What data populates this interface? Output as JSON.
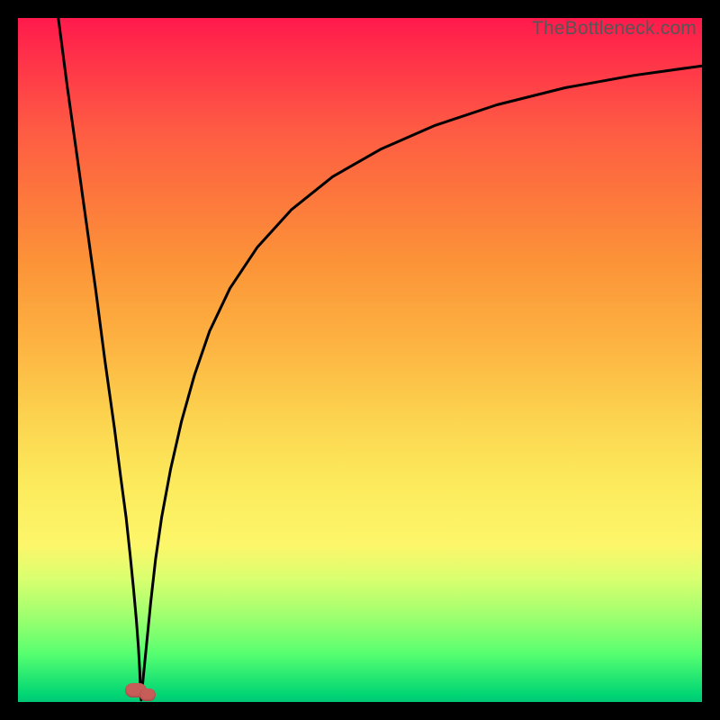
{
  "watermark": "TheBottleneck.com",
  "accent_color": "#c75d59",
  "curve_stroke": "#000000",
  "curve_stroke_width": 3,
  "chart_data": {
    "type": "line",
    "title": "",
    "xlabel": "",
    "ylabel": "",
    "xlim": [
      0,
      100
    ],
    "ylim": [
      0,
      100
    ],
    "gradient_stops": [
      {
        "pos": 0.0,
        "color": "#ff1a4c"
      },
      {
        "pos": 0.25,
        "color": "#fd743d"
      },
      {
        "pos": 0.58,
        "color": "#fcd24e"
      },
      {
        "pos": 0.77,
        "color": "#fdf66a"
      },
      {
        "pos": 0.95,
        "color": "#33ff70"
      },
      {
        "pos": 1.0,
        "color": "#00c676"
      }
    ],
    "left_branch": {
      "x": [
        5.9,
        7.2,
        8.6,
        10.0,
        11.4,
        12.7,
        14.1,
        15.0,
        15.8,
        16.4,
        16.9,
        17.3,
        17.6,
        17.8,
        17.9,
        18.0
      ],
      "y": [
        100.0,
        90.0,
        80.0,
        70.0,
        60.0,
        50.0,
        40.0,
        33.0,
        27.0,
        21.5,
        16.5,
        12.0,
        8.0,
        4.5,
        2.0,
        0.3
      ]
    },
    "right_branch": {
      "x": [
        18.0,
        18.3,
        18.8,
        19.4,
        20.1,
        21.0,
        22.3,
        23.9,
        25.8,
        28.0,
        31.0,
        35.0,
        40.0,
        46.0,
        53.0,
        61.0,
        70.0,
        80.0,
        90.0,
        100.0
      ],
      "y": [
        0.3,
        3.5,
        8.5,
        14.5,
        20.8,
        27.0,
        34.0,
        41.0,
        47.8,
        54.2,
        60.5,
        66.5,
        72.0,
        76.8,
        80.8,
        84.3,
        87.3,
        89.8,
        91.6,
        93.0
      ]
    },
    "marker": {
      "x": 17.5,
      "y": 1.5
    }
  }
}
